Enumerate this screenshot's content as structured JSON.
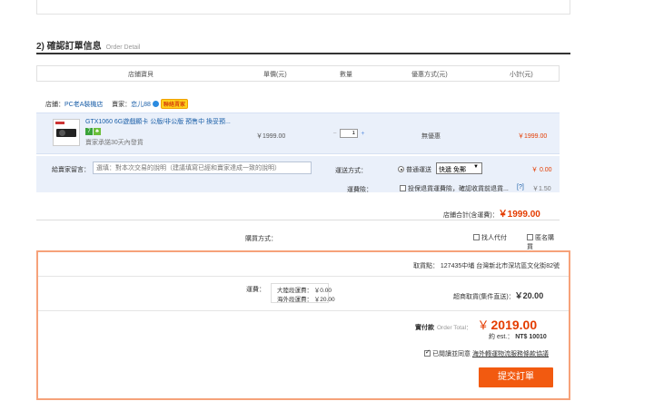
{
  "section": {
    "number_title": "2) 確認訂單信息",
    "subtitle": "Order Detail"
  },
  "table_headers": [
    "店鋪寶貝",
    "單價(元)",
    "數量",
    "優惠方式(元)",
    "小計(元)"
  ],
  "shop": {
    "shop_label": "店鋪：",
    "shop_name": "PC老A裝機店",
    "seller_label": "賣家：",
    "seller_name": "恋儿88",
    "seller_badge": "聯絡賣家"
  },
  "item": {
    "title": "GTX1060 6G遊戲顯卡 公版/非公版 預售中 換妥預...",
    "tag1": "7",
    "promise": "賣家承諾30天內發貨",
    "unit_price": "￥1999.00",
    "quantity": "1",
    "discount": "無優惠",
    "subtotal": "￥1999.00"
  },
  "message": {
    "label": "給賣家留言：",
    "placeholder": "選填：對本次交易的說明（建議填寫已經和賣家達成一致的說明）"
  },
  "shipping": {
    "label": "運送方式：",
    "option": "普通運送",
    "selected": "快遞 免郵",
    "price": "￥ 0.00"
  },
  "insurance": {
    "label": "運費險：",
    "option": "投保退貨運費險，確認收貨前退貨...",
    "help": "[?]",
    "price": "￥1.50"
  },
  "shop_total": {
    "label": "店鋪合計(含運費)：",
    "amount": "￥1999.00"
  },
  "payment": {
    "label": "購買方式：",
    "agent": "找人代付",
    "anonymous": "匿名購買"
  },
  "summary": {
    "pickup": "取貨點：  127435中埔 台灣新北市深坑區文化街82號",
    "fee_label": "運費：",
    "fee_mainland": "大陸段運費：   ￥0.00",
    "fee_overseas": "海外段運費：   ￥20.00",
    "pickup_fee_label": "超商取貨(集件直送)：",
    "pickup_fee_amount": "￥20.00",
    "total_label": "實付款",
    "total_en": "Order Total：",
    "total_currency": "￥",
    "total_amount": "2019.00",
    "est_label": "約  est.：",
    "est_amount": "NT$ 10010",
    "agree_text": "已閱讀並同意",
    "agree_link": "海外轉運物流服務條款協議",
    "submit": "提交訂單"
  },
  "colors": {
    "accent": "#f25a10",
    "price_red": "#e43c00",
    "link_blue": "#1b5fa8",
    "item_bg": "#eaf0fa",
    "summary_border": "#f6a27a"
  }
}
